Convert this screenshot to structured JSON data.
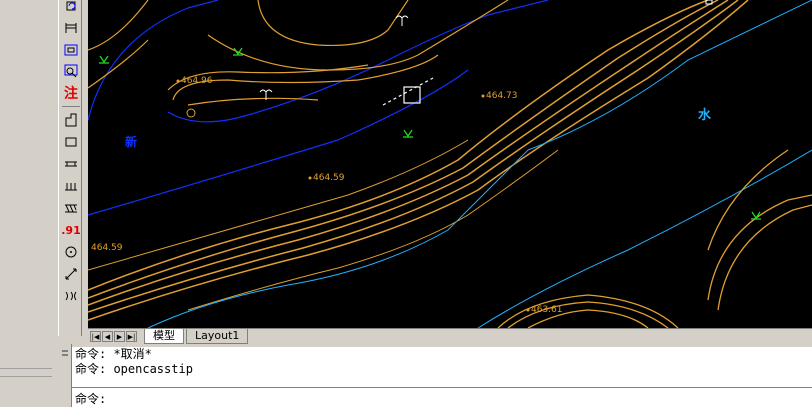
{
  "toolbar": {
    "annotate_label": "注",
    "number_label": ".91"
  },
  "drawing": {
    "elevations": [
      "464.96",
      "464.73",
      "464.59",
      "464.59",
      "463.61"
    ],
    "symbols": {
      "shui": "水",
      "xin": "新"
    },
    "colors": {
      "background": "#000000",
      "contour": "#e0a030",
      "boundary": "#1030ff",
      "river": "#20b0ff",
      "vegetation": "#20e020"
    }
  },
  "tabs": {
    "model": "模型",
    "layout1": "Layout1"
  },
  "command": {
    "history": [
      "命令: *取消*",
      "命令: opencasstip"
    ],
    "prompt": "命令:"
  }
}
